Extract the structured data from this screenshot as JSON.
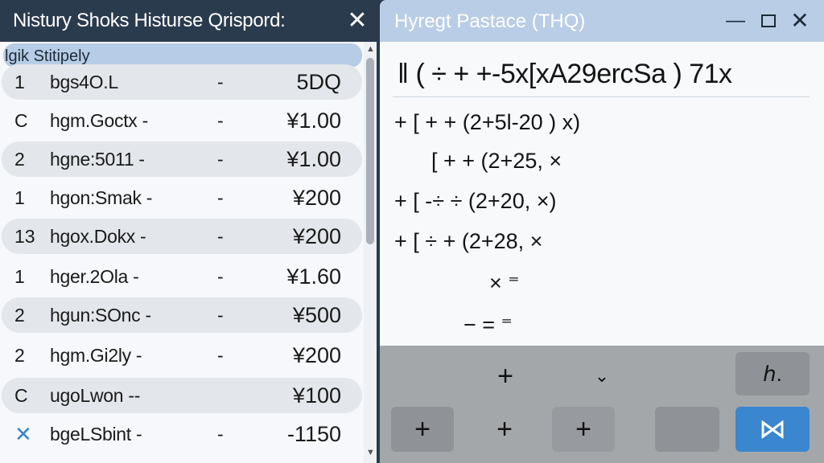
{
  "left_window": {
    "title": "Nistury Shoks Histurse Qrispord:",
    "close_glyph": "✕",
    "list_header": "lgik Stitipely",
    "rows": [
      {
        "qty": "1",
        "name": "bgs4O.L",
        "dash": "-",
        "price": "5DQ",
        "alt": true
      },
      {
        "qty": "C",
        "name": "hgm.Goctx -",
        "dash": "-",
        "price": "¥1.00",
        "alt": false
      },
      {
        "qty": "2",
        "name": "hgne:5011 -",
        "dash": "-",
        "price": "¥1.00",
        "alt": true
      },
      {
        "qty": "1",
        "name": "hgon:Smak -",
        "dash": "-",
        "price": "¥200",
        "alt": false
      },
      {
        "qty": "13",
        "name": "hgox.Dokx -",
        "dash": "-",
        "price": "¥200",
        "alt": true
      },
      {
        "qty": "1",
        "name": "hger.2Ola -",
        "dash": "-",
        "price": "¥1.60",
        "alt": false
      },
      {
        "qty": "2",
        "name": "hgun:SOnc -",
        "dash": "-",
        "price": "¥500",
        "alt": true
      },
      {
        "qty": "2",
        "name": "hgm.Gi2ly -",
        "dash": "-",
        "price": "¥200",
        "alt": false
      },
      {
        "qty": "C",
        "name": "ugoLwon --",
        "dash": "",
        "price": "¥100",
        "alt": true
      },
      {
        "qty": "✕",
        "name": "bgeLSbint -",
        "dash": "-",
        "price": "-1150",
        "alt": false,
        "icon": true
      }
    ],
    "scrollbar": {
      "up_glyph": "▲",
      "down_glyph": "▼"
    }
  },
  "right_window": {
    "title": "Hyregt Pastace (THQ)",
    "controls": {
      "minimize": "—",
      "close": "✕"
    },
    "expression": "‖ ( ÷ + +-5x[xA29ercSa ) 71x",
    "work_lines": [
      "+ [ + + (2+5l-20 ) x)",
      "[ + + (2+25, ×",
      "+ [ -÷ ÷ (2+20, ×)",
      "+ [ ÷ + (2+28, ×",
      "× ⁼",
      "− = ⁼"
    ],
    "keypad": {
      "row1": {
        "plus": "+",
        "chevron": "⌄",
        "special": "ℎ."
      },
      "row2": {
        "plus_a": "+",
        "plus_b": "+",
        "plus_c": "+",
        "blank": "",
        "equals": "⋈"
      }
    }
  },
  "colors": {
    "left_titlebar": "#2b3b4e",
    "right_titlebar": "#b9cde6",
    "list_header": "#b7cce6",
    "alt_row": "#e3e6ea",
    "keypad_bg": "#a4a7aa",
    "primary_key": "#3a86cf"
  }
}
